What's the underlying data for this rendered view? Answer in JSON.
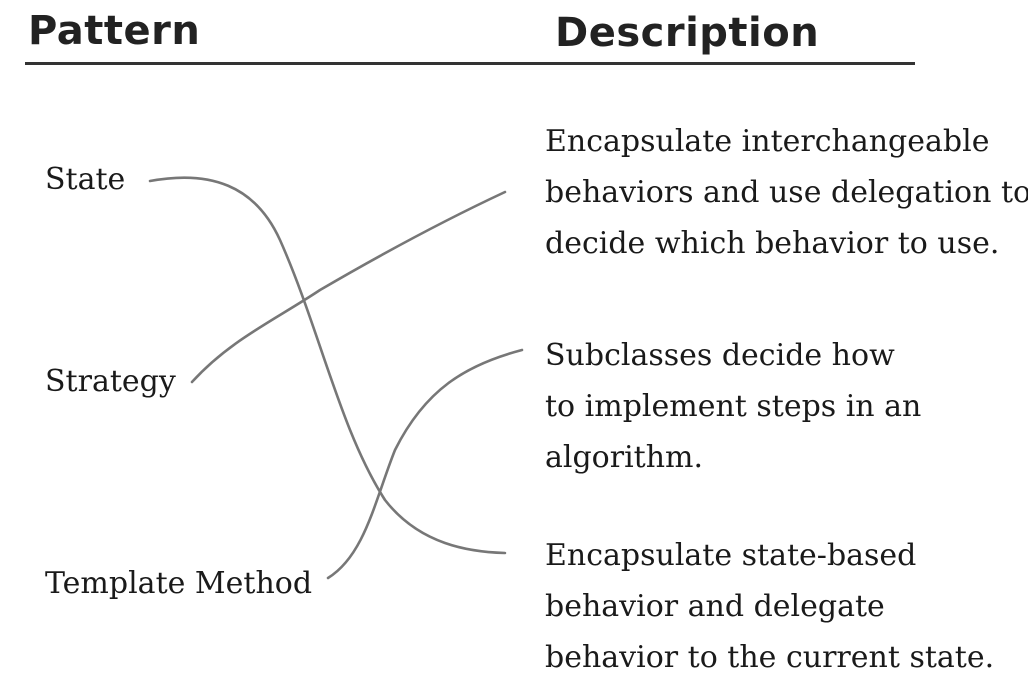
{
  "headers": {
    "pattern": "Pattern",
    "description": "Description"
  },
  "patterns": [
    {
      "name": "State"
    },
    {
      "name": "Strategy"
    },
    {
      "name": "Template Method"
    }
  ],
  "descriptions": [
    {
      "lines": [
        "Encapsulate interchangeable",
        "behaviors and use delegation to",
        "decide which behavior to use."
      ]
    },
    {
      "lines": [
        "Subclasses decide how",
        "to implement steps in an",
        "algorithm."
      ]
    },
    {
      "lines": [
        "Encapsulate state-based",
        "behavior and delegate",
        "behavior to the current state."
      ]
    }
  ],
  "colors": {
    "connector": "#777777",
    "text": "#1a1a1a",
    "rule": "#333333"
  }
}
